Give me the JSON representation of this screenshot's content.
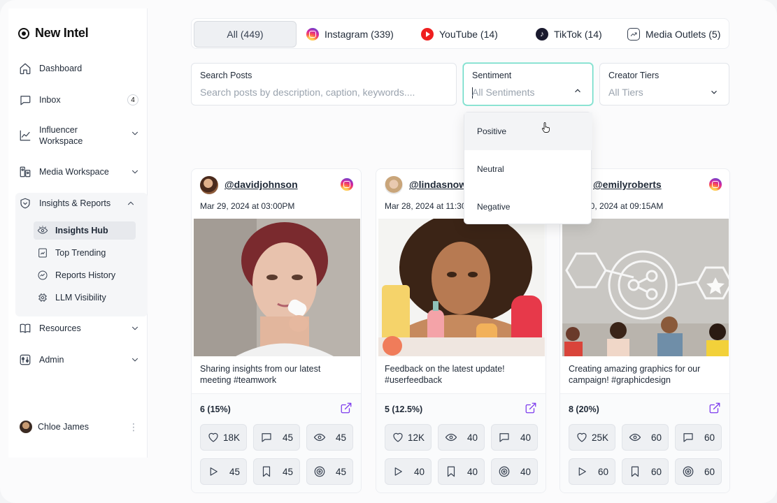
{
  "app": {
    "name": "New Intel"
  },
  "sidebar": {
    "items": [
      {
        "label": "Dashboard"
      },
      {
        "label": "Inbox",
        "badge": "4"
      },
      {
        "label": "Influencer Workspace"
      },
      {
        "label": "Media Workspace"
      },
      {
        "label": "Insights & Reports"
      },
      {
        "label": "Resources"
      },
      {
        "label": "Admin"
      }
    ],
    "insights_sub": [
      {
        "label": "Insights Hub"
      },
      {
        "label": "Top Trending"
      },
      {
        "label": "Reports History"
      },
      {
        "label": "LLM Visibility"
      }
    ],
    "user": {
      "name": "Chloe James"
    }
  },
  "tabs": [
    {
      "label": "All (449)"
    },
    {
      "label": "Instagram (339)"
    },
    {
      "label": "YouTube (14)"
    },
    {
      "label": "TikTok (14)"
    },
    {
      "label": "Media Outlets (5)"
    }
  ],
  "filters": {
    "search": {
      "label": "Search Posts",
      "placeholder": "Search posts by description, caption, keywords...."
    },
    "sentiment": {
      "label": "Sentiment",
      "value": "All Sentiments",
      "options": [
        "Positive",
        "Neutral",
        "Negative"
      ]
    },
    "tiers": {
      "label": "Creator Tiers",
      "value": "All Tiers"
    }
  },
  "posts": [
    {
      "handle": "@davidjohnson",
      "date": "Mar 29, 2024 at 03:00PM",
      "caption": "Sharing insights from our latest meeting #teamwork",
      "engagement": "6 (15%)",
      "metrics": [
        "18K",
        "45",
        "45",
        "45",
        "45",
        "45"
      ]
    },
    {
      "handle": "@lindasnow",
      "date": "Mar 28, 2024 at 11:30AM",
      "caption": "Feedback on the latest update! #userfeedback",
      "engagement": "5 (12.5%)",
      "metrics": [
        "12K",
        "40",
        "40",
        "40",
        "40",
        "40"
      ]
    },
    {
      "handle": "@emilyroberts",
      "date": "Mar 30, 2024 at 09:15AM",
      "caption": "Creating amazing graphics for our campaign! #graphicdesign",
      "engagement": "8 (20%)",
      "metrics": [
        "25K",
        "60",
        "60",
        "60",
        "60",
        "60"
      ]
    }
  ],
  "colors": {
    "accent": "#7c3aed",
    "focus": "#64d8c4"
  }
}
